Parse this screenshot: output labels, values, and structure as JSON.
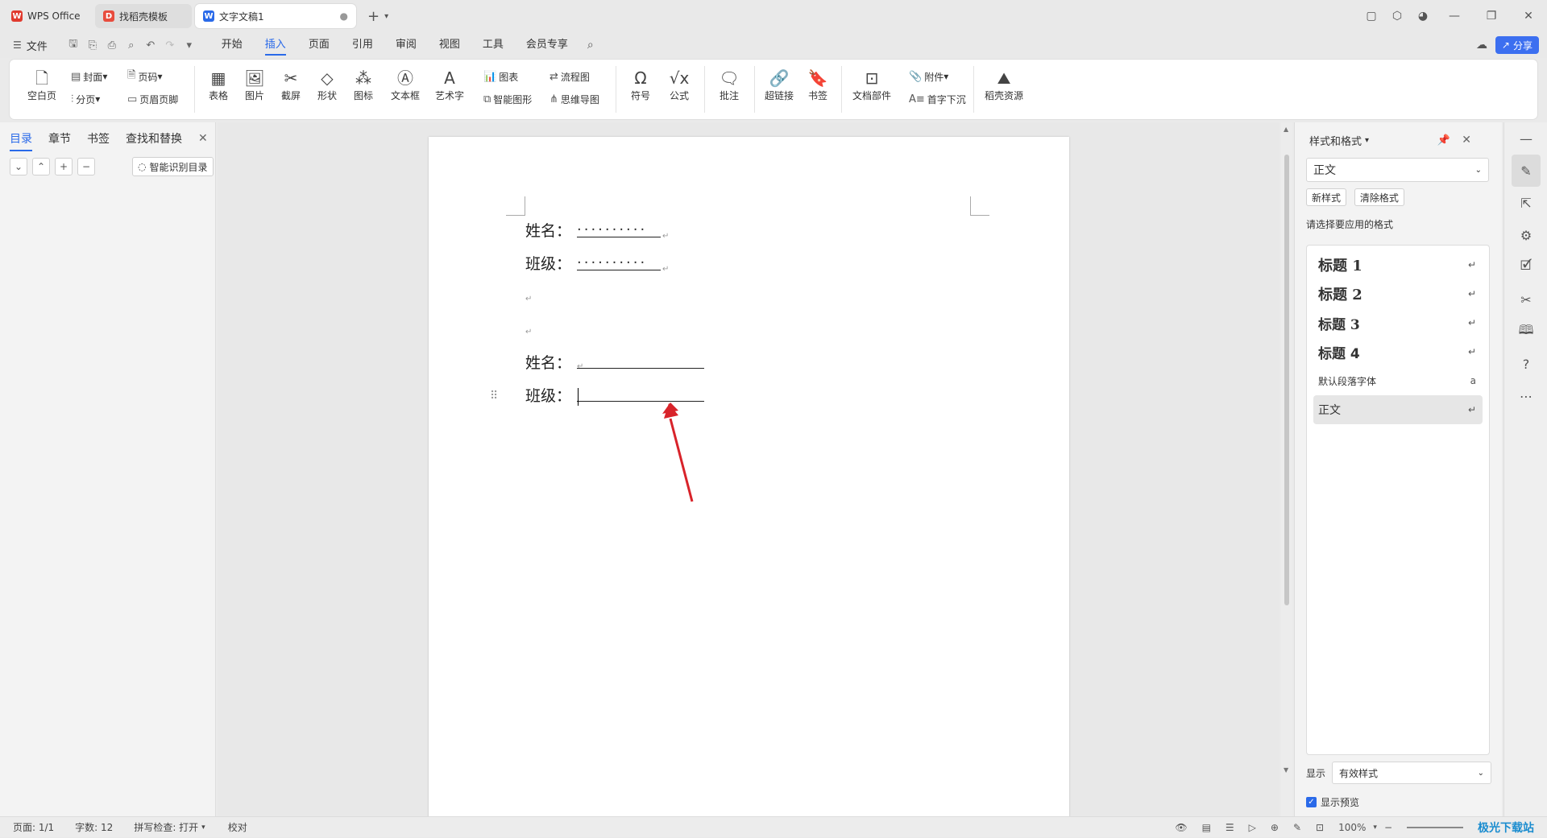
{
  "titlebar": {
    "tabs": [
      {
        "label": "WPS Office",
        "icon": "wps-logo-icon",
        "color": "#e03a2e"
      },
      {
        "label": "找稻壳模板",
        "icon": "docer-icon",
        "color": "#e84c3d"
      },
      {
        "label": "文字文稿1",
        "icon": "writer-icon",
        "color": "#2a6ae9"
      }
    ],
    "new_tab": "+",
    "window_controls": [
      "—",
      "❐",
      "✕"
    ]
  },
  "menubar": {
    "file": "文件",
    "items": [
      "开始",
      "插入",
      "页面",
      "引用",
      "审阅",
      "视图",
      "工具",
      "会员专享"
    ],
    "active": "插入",
    "share": "分享"
  },
  "ribbon": {
    "blank_page": "空白页",
    "cover": "封面",
    "page_number": "页码",
    "page_break": "分页",
    "header_footer": "页眉页脚",
    "table": "表格",
    "picture": "图片",
    "screenshot": "截屏",
    "shape": "形状",
    "icon": "图标",
    "textbox": "文本框",
    "wordart": "艺术字",
    "chart": "图表",
    "smart_graphic": "智能图形",
    "flowchart": "流程图",
    "mindmap": "思维导图",
    "symbol": "符号",
    "formula": "公式",
    "comment": "批注",
    "hyperlink": "超链接",
    "bookmark": "书签",
    "doc_parts": "文档部件",
    "attachment": "附件",
    "drop_cap": "首字下沉",
    "docer_resources": "稻壳资源"
  },
  "leftpanel": {
    "tabs": [
      "目录",
      "章节",
      "书签",
      "查找和替换"
    ],
    "active": "目录",
    "smart_toc": "智能识别目录"
  },
  "document": {
    "line1_label": "姓名：",
    "line2_label": "班级：",
    "line5_label": "姓名：",
    "line6_label": "班级：",
    "dots": "··········",
    "para_mark": "↵"
  },
  "rightpanel": {
    "title": "样式和格式",
    "current_style": "正文",
    "new_style": "新样式",
    "clear_format": "清除格式",
    "prompt": "请选择要应用的格式",
    "styles": [
      {
        "label": "标题 1",
        "mark": "↵"
      },
      {
        "label": "标题 2",
        "mark": "↵"
      },
      {
        "label": "标题 3",
        "mark": "↵"
      },
      {
        "label": "标题 4",
        "mark": "↵"
      },
      {
        "label": "默认段落字体",
        "mark": "a"
      },
      {
        "label": "正文",
        "mark": "↵"
      }
    ],
    "show_label": "显示",
    "show_value": "有效样式",
    "preview_label": "显示预览"
  },
  "statusbar": {
    "page": "页面: 1/1",
    "words": "字数: 12",
    "spell": "拼写检查: 打开",
    "proof": "校对",
    "zoom": "100%"
  },
  "watermark": "极光下载站"
}
